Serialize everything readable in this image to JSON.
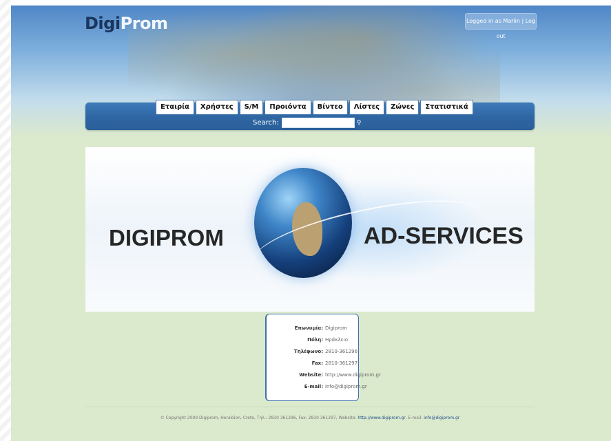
{
  "logo": {
    "part1": "Digi",
    "part2": "Prom"
  },
  "login_text": "Logged in as Marlin | Log out",
  "nav": {
    "tabs": [
      "Εταιρία",
      "Χρήστες",
      "S/M",
      "Προιόντα",
      "Βίντεο",
      "Λίστες",
      "Ζώνες",
      "Στατιστικά"
    ],
    "search_label": "Search:",
    "search_value": ""
  },
  "banner": {
    "left_text": "DIGIPROM",
    "right_text": "AD-SERVICES"
  },
  "contact": {
    "rows": [
      {
        "label": "Επωνυμία:",
        "value": "Digiprom"
      },
      {
        "label": "Πόλη:",
        "value": "Ηράκλειο"
      },
      {
        "label": "Τηλέφωνο:",
        "value": "2810-361296"
      },
      {
        "label": "Fax:",
        "value": "2810-361297"
      },
      {
        "label": "Website:",
        "value": "http://www.digiprom.gr"
      },
      {
        "label": "E-mail:",
        "value": "info@digiprom.gr"
      }
    ]
  },
  "footer": {
    "text": "© Copyright 2009 Digiprom, Heraklion, Crete, Τηλ.: 2810 361296, Fax: 2810 361297, Website: ",
    "website_link": "http://www.digiprom.gr",
    "email_prefix": ", E-mail: ",
    "email_link": "info@digiprom.gr"
  },
  "colors": {
    "nav_blue": "#2e66a3",
    "page_green": "#dbe9cd",
    "logo_dark": "#1b355e"
  }
}
